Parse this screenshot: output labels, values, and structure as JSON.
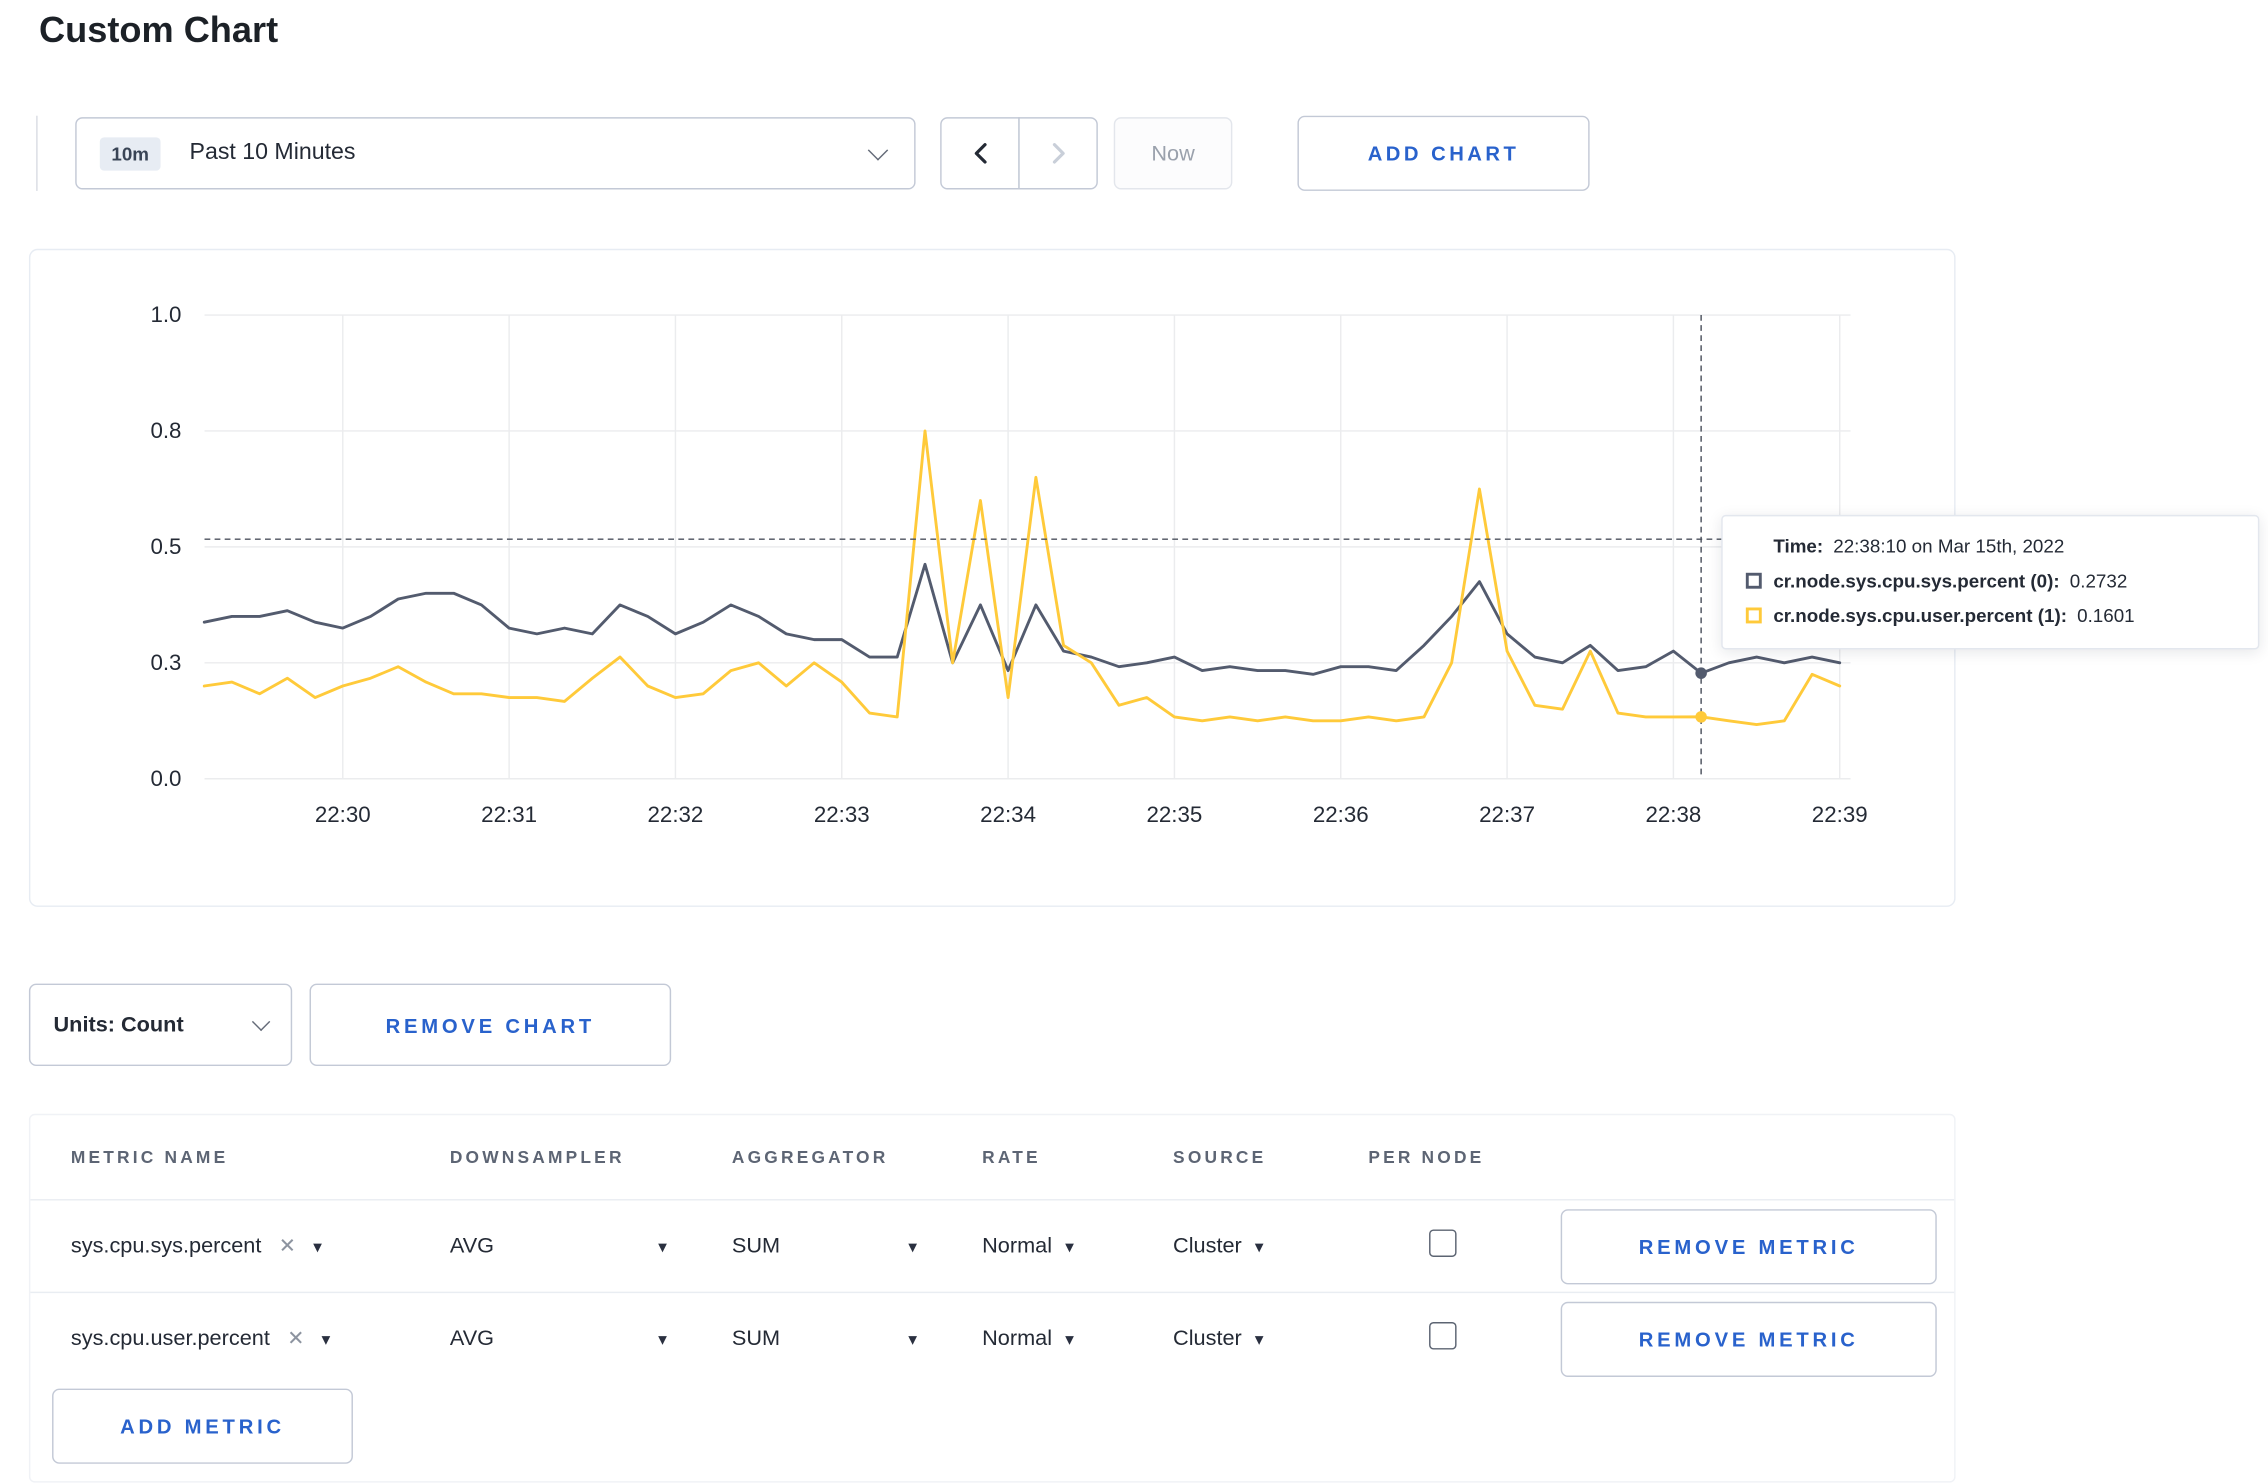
{
  "colors": {
    "accent_blue": "#2962cc",
    "text_dark": "#242a35",
    "grid": "#ebecee",
    "crosshair": "#4c525e",
    "series_sys": "#535b6e",
    "series_user": "#ffca3a"
  },
  "page": {
    "title": "Custom Chart"
  },
  "toolbar": {
    "range_badge": "10m",
    "range_label": "Past 10 Minutes",
    "now_label": "Now",
    "add_chart_label": "ADD CHART"
  },
  "chart_data": {
    "type": "line",
    "x_start": "22:29:10",
    "x_interval_seconds": 10,
    "x_ticks": [
      "22:30",
      "22:31",
      "22:32",
      "22:33",
      "22:34",
      "22:35",
      "22:36",
      "22:37",
      "22:38",
      "22:39"
    ],
    "y_ticks": [
      "1.0",
      "0.8",
      "0.5",
      "0.3",
      "0.0"
    ],
    "y_tick_values": [
      1.0,
      0.8,
      0.5,
      0.3,
      0.0
    ],
    "grid": true,
    "series": [
      {
        "name": "cr.node.sys.cpu.sys.percent",
        "color": "#535b6e",
        "values": [
          0.37,
          0.38,
          0.38,
          0.39,
          0.37,
          0.36,
          0.38,
          0.41,
          0.42,
          0.42,
          0.4,
          0.36,
          0.35,
          0.36,
          0.35,
          0.4,
          0.38,
          0.35,
          0.37,
          0.4,
          0.38,
          0.35,
          0.34,
          0.34,
          0.31,
          0.31,
          0.47,
          0.3,
          0.4,
          0.28,
          0.4,
          0.32,
          0.31,
          0.29,
          0.3,
          0.31,
          0.28,
          0.29,
          0.28,
          0.28,
          0.27,
          0.29,
          0.29,
          0.28,
          0.33,
          0.38,
          0.44,
          0.35,
          0.31,
          0.3,
          0.33,
          0.28,
          0.29,
          0.32,
          0.2732,
          0.3,
          0.31,
          0.3,
          0.31,
          0.3
        ]
      },
      {
        "name": "cr.node.sys.cpu.user.percent",
        "color": "#ffca3a",
        "values": [
          0.24,
          0.25,
          0.22,
          0.26,
          0.21,
          0.24,
          0.26,
          0.29,
          0.25,
          0.22,
          0.22,
          0.21,
          0.21,
          0.2,
          0.26,
          0.31,
          0.24,
          0.21,
          0.22,
          0.28,
          0.3,
          0.24,
          0.3,
          0.25,
          0.17,
          0.16,
          0.8,
          0.3,
          0.62,
          0.21,
          0.68,
          0.33,
          0.3,
          0.19,
          0.21,
          0.16,
          0.15,
          0.16,
          0.15,
          0.16,
          0.15,
          0.15,
          0.16,
          0.15,
          0.16,
          0.3,
          0.65,
          0.32,
          0.19,
          0.18,
          0.32,
          0.17,
          0.16,
          0.16,
          0.1601,
          0.15,
          0.14,
          0.15,
          0.27,
          0.24
        ]
      }
    ],
    "hover": {
      "index": 54,
      "time_key": "Time:",
      "time_label": "22:38:10 on Mar 15th, 2022",
      "hline_value": 0.52,
      "rows": [
        {
          "label": "cr.node.sys.cpu.sys.percent (0):",
          "value": "0.2732",
          "color": "#535b6e"
        },
        {
          "label": "cr.node.sys.cpu.user.percent (1):",
          "value": "0.1601",
          "color": "#ffca3a"
        }
      ]
    }
  },
  "chart_controls": {
    "units_label": "Units: Count",
    "remove_chart_label": "REMOVE CHART"
  },
  "metrics_table": {
    "headers": [
      "METRIC NAME",
      "DOWNSAMPLER",
      "AGGREGATOR",
      "RATE",
      "SOURCE",
      "PER NODE"
    ],
    "rows": [
      {
        "metric": "sys.cpu.sys.percent",
        "downsampler": "AVG",
        "aggregator": "SUM",
        "rate": "Normal",
        "source": "Cluster",
        "per_node": false,
        "remove_label": "REMOVE METRIC"
      },
      {
        "metric": "sys.cpu.user.percent",
        "downsampler": "AVG",
        "aggregator": "SUM",
        "rate": "Normal",
        "source": "Cluster",
        "per_node": false,
        "remove_label": "REMOVE METRIC"
      }
    ],
    "add_metric_label": "ADD METRIC"
  }
}
